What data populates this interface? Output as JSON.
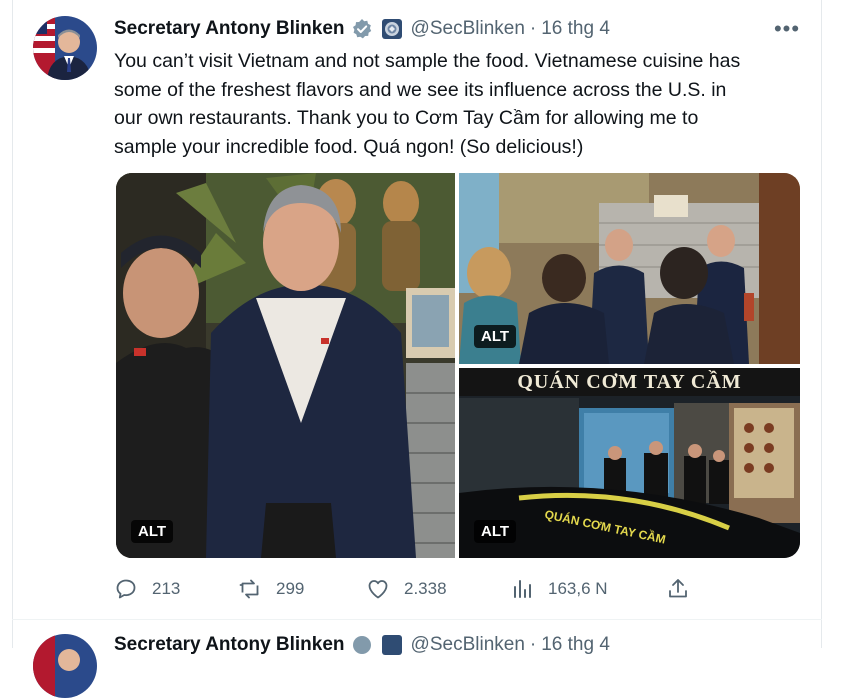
{
  "tweet": {
    "author_name": "Secretary Antony Blinken",
    "handle": "@SecBlinken",
    "separator": "·",
    "date": "16 thg 4",
    "more": "•••",
    "lines": [
      "You can’t visit Vietnam and not sample the food. Vietnamese cuisine has",
      "some of the freshest flavors and we see its influence across the U.S. in",
      "our own restaurants. Thank you to Cơm Tay Cầm for allowing me to",
      "sample your incredible food. Quá ngon! (So delicious!)"
    ],
    "alt_label": "ALT",
    "storefront_sign": "QUÁN CƠM TAY CẦM",
    "stats": {
      "replies": "213",
      "reposts": "299",
      "likes": "2.338",
      "views": "163,6 N"
    }
  },
  "next_tweet": {
    "author_name": "Secretary Antony Blinken",
    "handle": "@SecBlinken",
    "separator": "·",
    "date": "16 thg 4"
  },
  "colors": {
    "text": "#0f1419",
    "muted": "#536471",
    "verified": "#829aab"
  },
  "icons": [
    "verified-badge-icon",
    "government-seal-icon",
    "more-icon",
    "reply-icon",
    "repost-icon",
    "like-icon",
    "views-icon",
    "share-icon"
  ]
}
